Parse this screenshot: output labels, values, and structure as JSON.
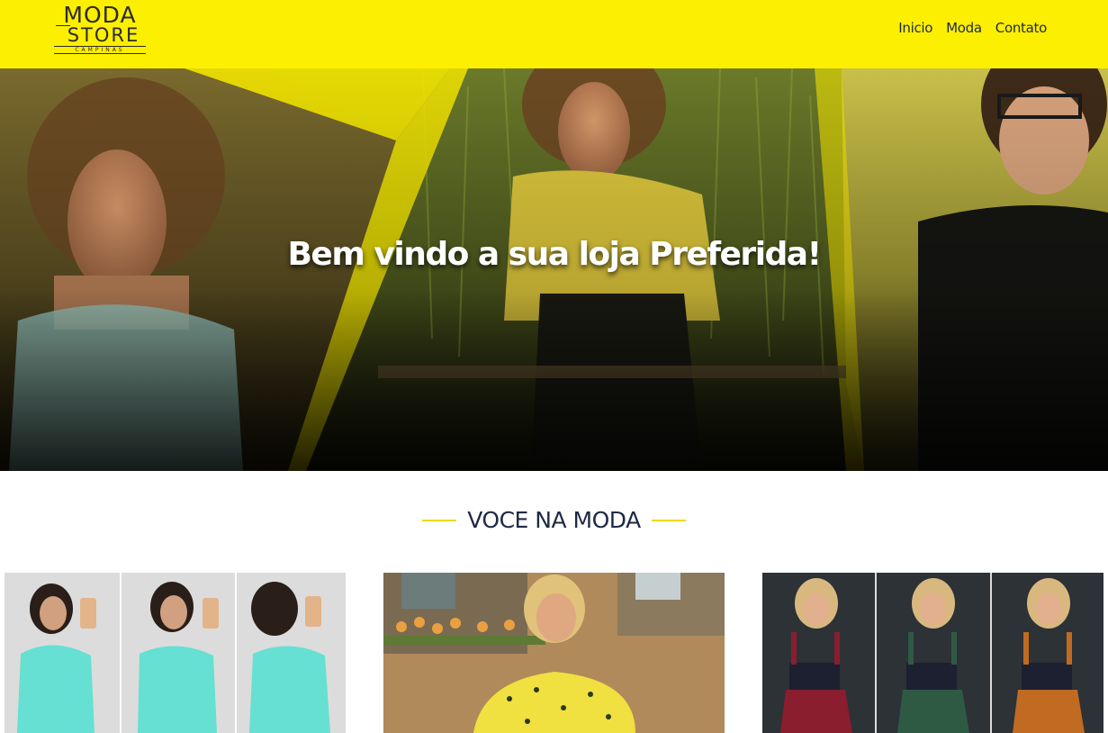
{
  "header": {
    "logo": {
      "line1": "MODA",
      "line2": "STORE",
      "line3": "CAMPINAS"
    },
    "nav": [
      {
        "label": "Inicio"
      },
      {
        "label": "Moda"
      },
      {
        "label": "Contato"
      }
    ],
    "background": "#fdef00"
  },
  "hero": {
    "title": "Bem vindo a sua loja Preferida!"
  },
  "section": {
    "title": "VOCE NA MODA",
    "accent": "#f0d800"
  },
  "products": [
    {
      "image": "three-poses-mint-cami-top"
    },
    {
      "image": "yellow-heart-print-top"
    },
    {
      "image": "three-overall-skirts-burgundy-green-orange"
    }
  ]
}
